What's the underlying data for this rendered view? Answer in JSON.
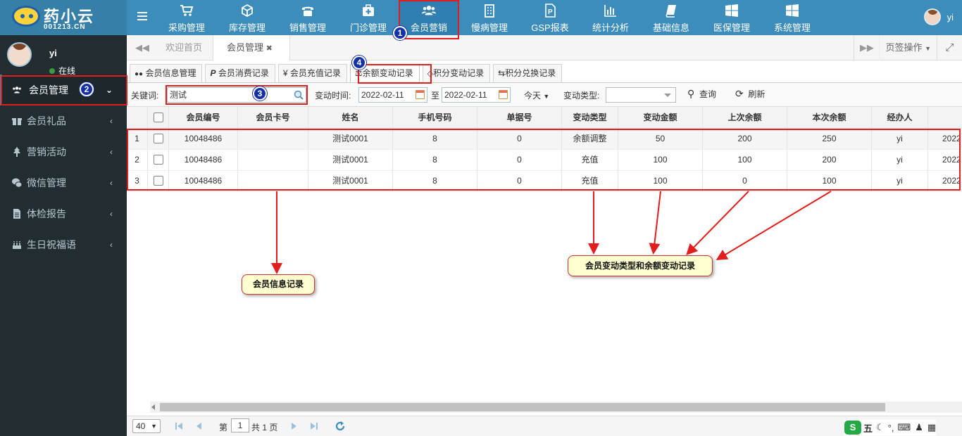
{
  "app": {
    "logo_text": "药小云",
    "logo_domain": "001213.CN",
    "user": "yi"
  },
  "topnav": [
    {
      "label": "采购管理",
      "icon": "cart-icon"
    },
    {
      "label": "库存管理",
      "icon": "cube-icon"
    },
    {
      "label": "销售管理",
      "icon": "phone-icon"
    },
    {
      "label": "门诊管理",
      "icon": "medkit-icon"
    },
    {
      "label": "会员营销",
      "icon": "users-icon"
    },
    {
      "label": "慢病管理",
      "icon": "hospital-icon"
    },
    {
      "label": "GSP报表",
      "icon": "p-doc-icon"
    },
    {
      "label": "统计分析",
      "icon": "bar-chart-icon"
    },
    {
      "label": "基础信息",
      "icon": "book-icon"
    },
    {
      "label": "医保管理",
      "icon": "windows-icon"
    },
    {
      "label": "系统管理",
      "icon": "windows-icon"
    }
  ],
  "sidebar": {
    "username": "yi",
    "status": "在线",
    "items": [
      {
        "label": "会员管理",
        "icon": "users-icon",
        "arrow": "⌄"
      },
      {
        "label": "会员礼品",
        "icon": "gift-icon",
        "arrow": "‹"
      },
      {
        "label": "营销活动",
        "icon": "tree-icon",
        "arrow": "‹"
      },
      {
        "label": "微信管理",
        "icon": "wechat-icon",
        "arrow": "‹"
      },
      {
        "label": "体检报告",
        "icon": "file-icon",
        "arrow": "‹"
      },
      {
        "label": "生日祝福语",
        "icon": "cake-icon",
        "arrow": "‹"
      }
    ]
  },
  "page_tabs": {
    "home": "欢迎首页",
    "current": "会员管理",
    "close": "✖",
    "ops": "页签操作"
  },
  "sub_tabs": [
    "会员信息管理",
    "会员消费记录",
    "会员充值记录",
    "余额变动记录",
    "积分变动记录",
    "积分兑换记录"
  ],
  "filters": {
    "keyword_label": "关键词:",
    "keyword_value": "测试",
    "time_label": "变动时间:",
    "date_from": "2022-02-11",
    "to_label": "至",
    "date_to": "2022-02-11",
    "range": "今天",
    "type_label": "变动类型:",
    "type_value": "",
    "query": "查询",
    "refresh": "刷新"
  },
  "table": {
    "columns": [
      "",
      "",
      "会员编号",
      "会员卡号",
      "姓名",
      "手机号码",
      "单据号",
      "变动类型",
      "变动金额",
      "上次余额",
      "本次余额",
      "经办人",
      ""
    ],
    "rows": [
      {
        "idx": "1",
        "member_no": "10048486",
        "card_no": "",
        "name": "测试0001",
        "phone": "8",
        "doc_no": "0",
        "type": "余额调整",
        "amount": "50",
        "prev": "200",
        "curr": "250",
        "operator": "yi",
        "date": "2022"
      },
      {
        "idx": "2",
        "member_no": "10048486",
        "card_no": "",
        "name": "测试0001",
        "phone": "8",
        "doc_no": "0",
        "type": "充值",
        "amount": "100",
        "prev": "100",
        "curr": "200",
        "operator": "yi",
        "date": "2022"
      },
      {
        "idx": "3",
        "member_no": "10048486",
        "card_no": "",
        "name": "测试0001",
        "phone": "8",
        "doc_no": "0",
        "type": "充值",
        "amount": "100",
        "prev": "0",
        "curr": "100",
        "operator": "yi",
        "date": "2022"
      }
    ]
  },
  "pager": {
    "size": "40",
    "page_prefix": "第",
    "page": "1",
    "page_total": "共 1 页"
  },
  "ime": {
    "label": "五"
  },
  "annotations": {
    "callout_member": "会员信息记录",
    "callout_change": "会员变动类型和余额变动记录",
    "badges": [
      "1",
      "2",
      "3",
      "4"
    ]
  },
  "colors": {
    "topbar": "#3c8dbc",
    "sidebar": "#222d32",
    "highlight": "#e21d1d",
    "callout_bg": "#ffffd0",
    "badge": "#1531a8"
  }
}
